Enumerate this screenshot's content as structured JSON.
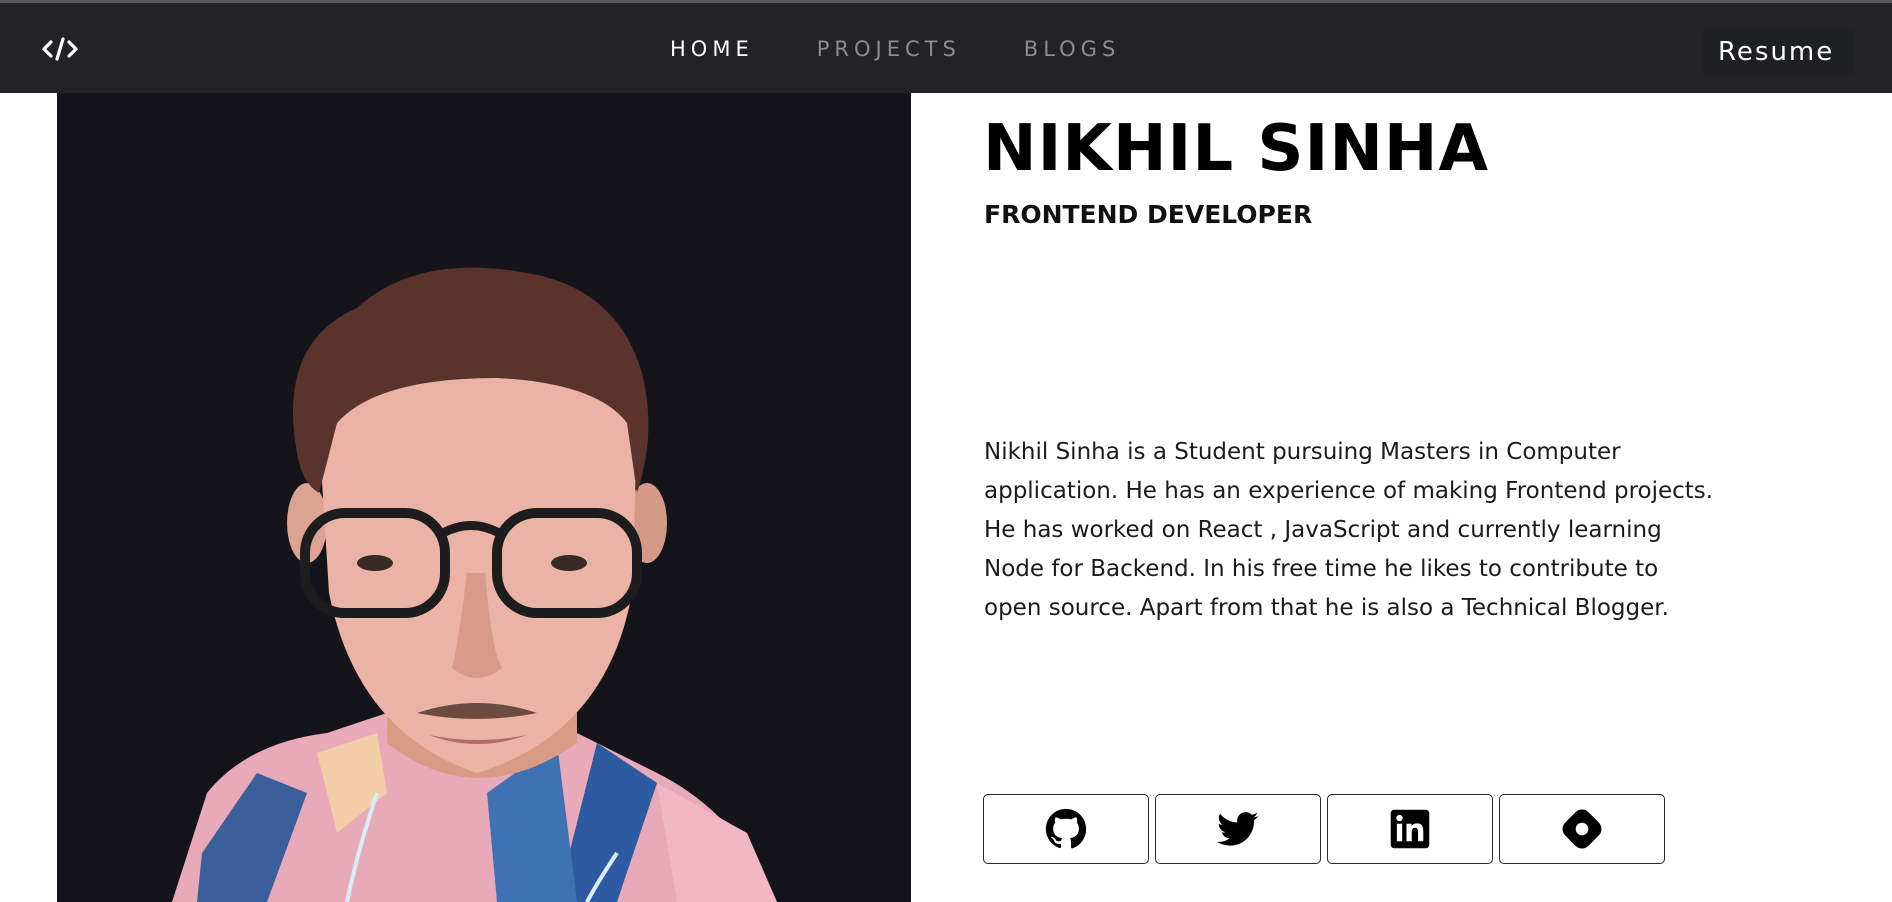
{
  "nav": {
    "logo_icon": "code-brackets-icon",
    "links": [
      {
        "label": "HOME",
        "active": true
      },
      {
        "label": "PROJECTS",
        "active": false
      },
      {
        "label": "BLOGS",
        "active": false
      }
    ],
    "resume_label": "Resume"
  },
  "hero": {
    "name": "NIKHIL SINHA",
    "role": "FRONTEND DEVELOPER",
    "bio": "Nikhil Sinha is a Student pursuing Masters in Computer application. He has an experience of making Frontend projects. He has worked on React , JavaScript and currently learning Node for Backend. In his free time he likes to contribute to open source. Apart from that he is also a Technical Blogger.",
    "photo_background": "#15141a"
  },
  "socials": [
    {
      "icon": "github-icon"
    },
    {
      "icon": "twitter-icon"
    },
    {
      "icon": "linkedin-icon"
    },
    {
      "icon": "hashnode-icon"
    }
  ],
  "colors": {
    "navbar_bg": "#232327",
    "nav_active": "#ffffff",
    "nav_inactive": "#8c8c90",
    "text_primary": "#000000"
  }
}
